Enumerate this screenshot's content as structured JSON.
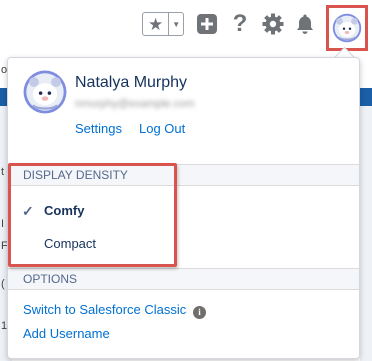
{
  "header": {
    "favorites_star": "★",
    "favorites_chevron": "▼",
    "help": "?"
  },
  "background": {
    "left_fragments": [
      "or",
      "t",
      "I",
      "F",
      "(",
      "1"
    ]
  },
  "profile": {
    "name": "Natalya Murphy",
    "email": "nmurphy@example.com",
    "settings_label": "Settings",
    "logout_label": "Log Out"
  },
  "display_density": {
    "header": "DISPLAY DENSITY",
    "options": [
      {
        "label": "Comfy",
        "selected": true,
        "check": "✓"
      },
      {
        "label": "Compact",
        "selected": false
      }
    ]
  },
  "options": {
    "header": "OPTIONS",
    "switch_label": "Switch to Salesforce Classic",
    "info": "i",
    "add_username_label": "Add Username"
  },
  "colors": {
    "link": "#0070d2",
    "highlight": "#d9534f",
    "icon_gray": "#6f7378"
  }
}
